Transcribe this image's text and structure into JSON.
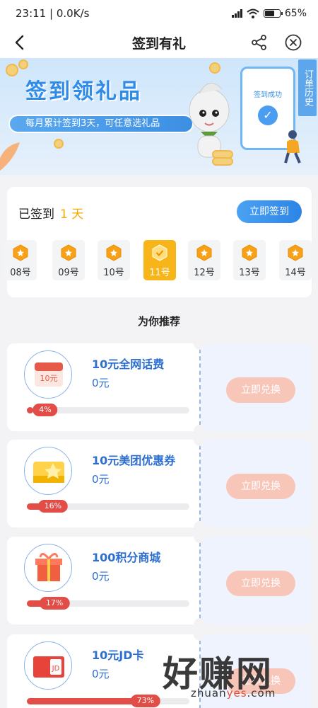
{
  "status_bar": {
    "time": "23:11",
    "speed": "0.0K/s",
    "battery": "65%",
    "battery_level": 0.65
  },
  "nav": {
    "title": "签到有礼",
    "icons": [
      "back-icon",
      "share-icon",
      "close-icon"
    ]
  },
  "banner": {
    "headline": "签到领礼品",
    "subtitle": "每月累计签到3天，可任意选礼品",
    "phone_text": "签到成功",
    "order_history": "订单历史"
  },
  "sign": {
    "signed_label": "已签到",
    "signed_days": "1 天",
    "button": "立即签到",
    "days": [
      {
        "label": "08号",
        "active": false
      },
      {
        "label": "09号",
        "active": false
      },
      {
        "label": "10号",
        "active": false
      },
      {
        "label": "11号",
        "active": true
      },
      {
        "label": "12号",
        "active": false
      },
      {
        "label": "13号",
        "active": false
      },
      {
        "label": "14号",
        "active": false
      }
    ]
  },
  "recommend_title": "为你推荐",
  "rewards": [
    {
      "name": "10元全网话费",
      "price": "0元",
      "progress": 0.04,
      "progress_label": "4%",
      "button": "立即兑换",
      "icon": "phone-credit-icon"
    },
    {
      "name": "10元美团优惠券",
      "price": "0元",
      "progress": 0.16,
      "progress_label": "16%",
      "button": "立即兑换",
      "icon": "meituan-coupon-icon"
    },
    {
      "name": "100积分商城",
      "price": "0元",
      "progress": 0.17,
      "progress_label": "17%",
      "button": "立即兑换",
      "icon": "gift-box-icon"
    },
    {
      "name": "10元JD卡",
      "price": "0元",
      "progress": 0.73,
      "progress_label": "73%",
      "button": "立即兑换",
      "icon": "jd-card-icon"
    }
  ],
  "watermark": {
    "brand": "好赚网",
    "url_prefix": "zhuan",
    "url_highlight": "yes",
    "url_suffix": ".com"
  },
  "colors": {
    "accent_blue": "#2c84e6",
    "sign_active": "#f7b51a",
    "progress_red": "#e24d47",
    "redeem_disabled": "#f8c6b9"
  }
}
